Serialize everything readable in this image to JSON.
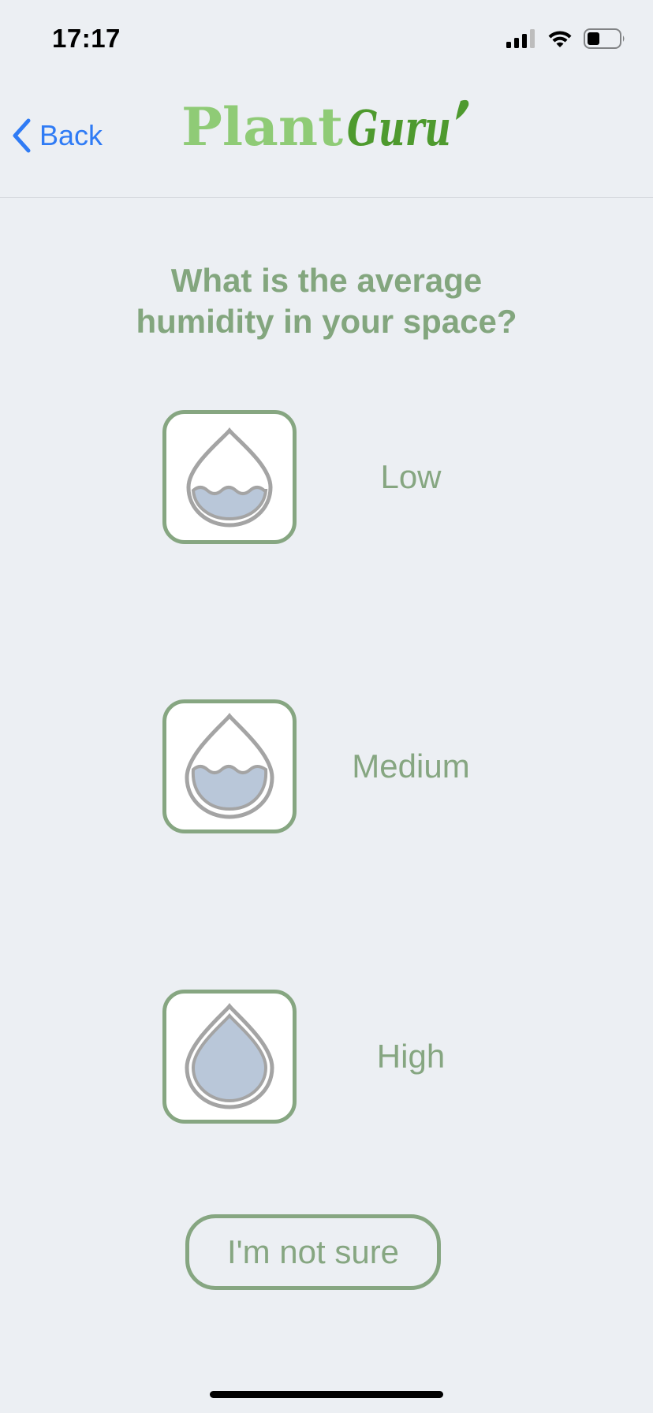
{
  "status_bar": {
    "time": "17:17",
    "icons": [
      "signal-icon",
      "wifi-icon",
      "battery-icon"
    ]
  },
  "nav": {
    "back_label": "Back",
    "logo": {
      "part1": "Plant",
      "part2": "Guru"
    }
  },
  "question": {
    "line1": "What is the average",
    "line2": "humidity in your space?"
  },
  "options": [
    {
      "label": "Low",
      "icon": "low-humidity-drop-icon"
    },
    {
      "label": "Medium",
      "icon": "medium-humidity-drop-icon"
    },
    {
      "label": "High",
      "icon": "high-humidity-drop-icon"
    }
  ],
  "not_sure_label": "I'm not sure",
  "colors": {
    "background": "#ECEFF3",
    "accent_green": "#86A681",
    "logo_light_green": "#8FCB76",
    "logo_dark_green": "#4E9A2E",
    "link_blue": "#2F7BF5",
    "drop_fill": "#B9C7D9",
    "drop_outline": "#A4A4A4"
  }
}
